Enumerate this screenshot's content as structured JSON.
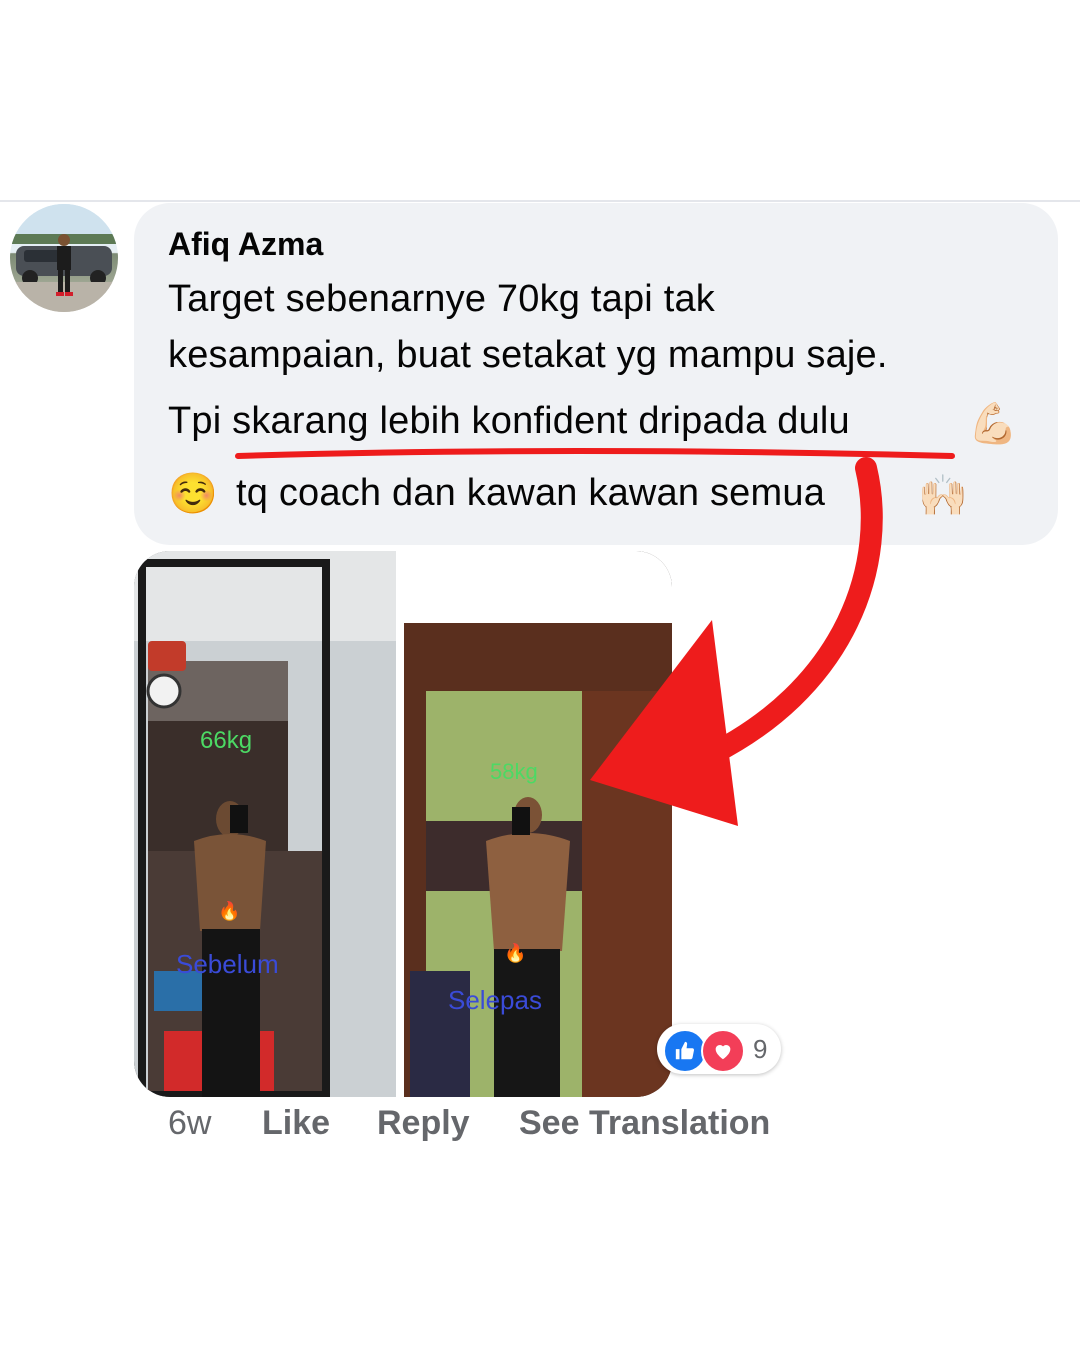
{
  "comment": {
    "author": "Afiq Azma",
    "lines": [
      "Target sebenarnye 70kg tapi tak",
      "kesampaian, buat setakat yg mampu saje.",
      "Tpi skarang lebih konfident dripada dulu",
      "tq coach dan kawan kawan semua"
    ],
    "emojis": {
      "muscle": "💪🏻",
      "smile": "☺️",
      "raised_hands": "🙌🏻"
    }
  },
  "photo": {
    "left_weight": "66kg",
    "left_caption": "Sebelum",
    "right_weight": "58kg",
    "right_caption": "Selepas",
    "fire": "🔥"
  },
  "reactions": {
    "count": "9",
    "like_color": "#1877f2",
    "love_color": "#f33e58"
  },
  "actions": {
    "time": "6w",
    "like": "Like",
    "reply": "Reply",
    "see_translation": "See Translation"
  },
  "annotation": {
    "color": "#ee1c1c"
  }
}
